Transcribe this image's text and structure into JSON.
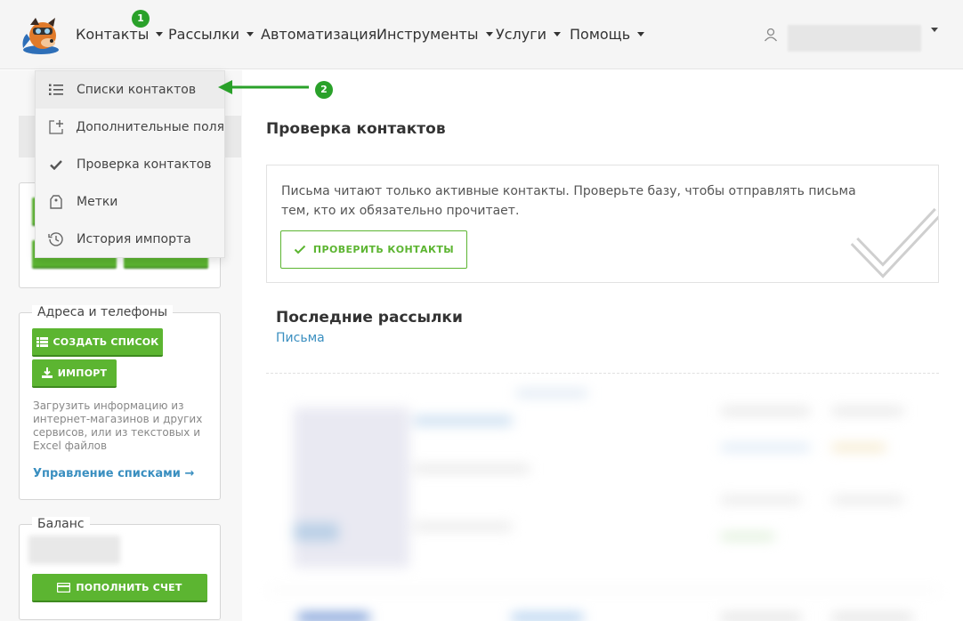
{
  "nav": {
    "items": [
      {
        "label": "Контакты",
        "has_caret": true
      },
      {
        "label": "Рассылки",
        "has_caret": true
      },
      {
        "label": "Автоматизация",
        "has_caret": false
      },
      {
        "label": "Инструменты",
        "has_caret": true
      },
      {
        "label": "Услуги",
        "has_caret": true
      },
      {
        "label": "Помощь",
        "has_caret": true
      }
    ],
    "badge1": "1",
    "badge2": "2"
  },
  "dropdown": {
    "items": [
      {
        "label": "Списки контактов",
        "icon": "list-icon"
      },
      {
        "label": "Дополнительные поля",
        "icon": "add-field-icon"
      },
      {
        "label": "Проверка контактов",
        "icon": "checkmark-icon"
      },
      {
        "label": "Метки",
        "icon": "tag-icon"
      },
      {
        "label": "История импорта",
        "icon": "history-icon"
      }
    ]
  },
  "sidebar": {
    "addresses": {
      "legend": "Адреса и телефоны",
      "create_list": "СОЗДАТЬ СПИСОК",
      "import": "ИМПОРТ",
      "hint": "Загрузить информацию из интернет-магазинов и других сервисов, или из текстовых и Excel файлов",
      "manage_link": "Управление списками →"
    },
    "balance": {
      "legend": "Баланс",
      "topup": "ПОПОЛНИТЬ СЧЕТ"
    }
  },
  "main": {
    "title": "Проверка контактов",
    "check_text": "Письма читают только активные контакты. Проверьте базу, чтобы отправлять письма тем, кто их обязательно прочитает.",
    "check_button": "ПРОВЕРИТЬ КОНТАКТЫ",
    "recent_title": "Последние рассылки",
    "recent_link": "Письма"
  },
  "colors": {
    "accent_green": "#5cb531",
    "badge_green": "#2aa12a",
    "link_blue": "#3a8fc0"
  }
}
